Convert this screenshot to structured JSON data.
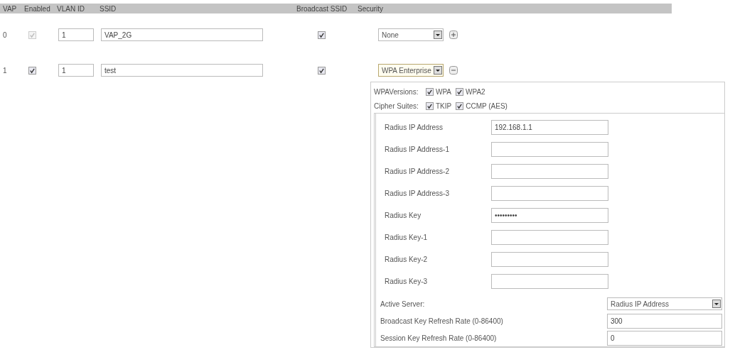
{
  "header": [
    "VAP",
    "Enabled",
    "VLAN ID",
    "SSID",
    "Broadcast SSID",
    "Security"
  ],
  "vaps": [
    {
      "index": "0",
      "enabled": true,
      "enabled_disabled": true,
      "vlan_id": "1",
      "ssid": "VAP_2G",
      "broadcast_ssid": true,
      "security": "None",
      "expanded": false
    },
    {
      "index": "1",
      "enabled": true,
      "enabled_disabled": false,
      "vlan_id": "1",
      "ssid": "test",
      "broadcast_ssid": true,
      "security": "WPA Enterprise",
      "expanded": true
    }
  ],
  "wpa_settings": {
    "versions": {
      "label": "WPAVersions:",
      "options": [
        {
          "label": "WPA",
          "checked": true
        },
        {
          "label": "WPA2",
          "checked": true
        }
      ]
    },
    "cipher_suites": {
      "label": "Cipher Suites:",
      "options": [
        {
          "label": "TKIP",
          "checked": true
        },
        {
          "label": "CCMP (AES)",
          "checked": true
        }
      ]
    },
    "radius_fields": [
      {
        "label": "Radius IP Address",
        "value": "192.168.1.1"
      },
      {
        "label": "Radius IP Address-1"
      },
      {
        "label": "Radius IP Address-2"
      },
      {
        "label": "Radius IP Address-3"
      },
      {
        "label": "Radius Key",
        "value": "•••••••••"
      },
      {
        "label": "Radius Key-1"
      },
      {
        "label": "Radius Key-2"
      },
      {
        "label": "Radius Key-3"
      }
    ],
    "active_server": {
      "label": "Active Server:",
      "value": "Radius IP Address"
    },
    "broadcast_key_refresh": {
      "label": "Broadcast Key Refresh Rate  (0-86400)",
      "value": "300"
    },
    "session_key_refresh": {
      "label": "Session Key Refresh Rate  (0-86400)",
      "value": "0"
    }
  }
}
